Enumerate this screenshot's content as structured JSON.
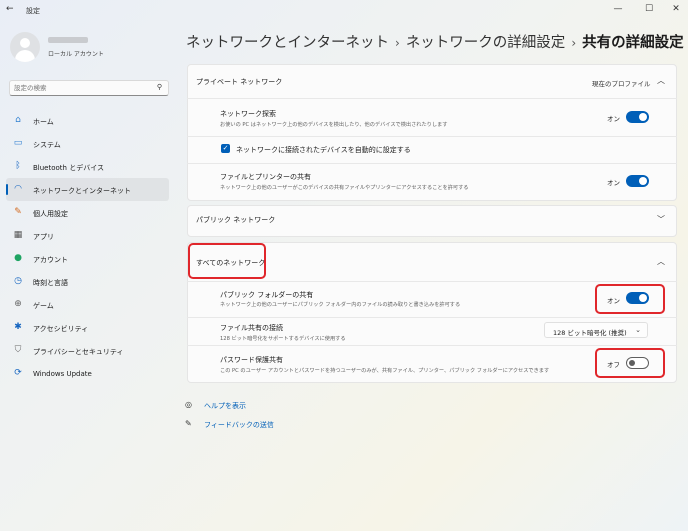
{
  "window": {
    "title": "設定",
    "back_icon": "back-arrow-icon",
    "controls": [
      "minimize",
      "maximize",
      "close"
    ]
  },
  "profile": {
    "account_type": "ローカル アカウント"
  },
  "search": {
    "placeholder": "設定の検索"
  },
  "sidebar": {
    "items": [
      {
        "label": "ホーム",
        "icon": "home-icon"
      },
      {
        "label": "システム",
        "icon": "system-icon"
      },
      {
        "label": "Bluetooth とデバイス",
        "icon": "bluetooth-icon"
      },
      {
        "label": "ネットワークとインターネット",
        "icon": "wifi-icon",
        "active": true
      },
      {
        "label": "個人用設定",
        "icon": "brush-icon"
      },
      {
        "label": "アプリ",
        "icon": "apps-icon"
      },
      {
        "label": "アカウント",
        "icon": "account-icon"
      },
      {
        "label": "時刻と言語",
        "icon": "globe-clock-icon"
      },
      {
        "label": "ゲーム",
        "icon": "gamepad-icon"
      },
      {
        "label": "アクセシビリティ",
        "icon": "accessibility-icon"
      },
      {
        "label": "プライバシーとセキュリティ",
        "icon": "shield-icon"
      },
      {
        "label": "Windows Update",
        "icon": "update-icon"
      }
    ]
  },
  "breadcrumb": {
    "level1": "ネットワークとインターネット",
    "level2": "ネットワークの詳細設定",
    "current": "共有の詳細設定",
    "separator": "›"
  },
  "private": {
    "header": "プライベート ネットワーク",
    "profile_status": "現在のプロファイル",
    "discovery": {
      "title": "ネットワーク探索",
      "desc": "お使いの PC はネットワーク上の他のデバイスを検出したり、他のデバイスで検出されたりします",
      "state": "オン",
      "on": true
    },
    "auto_setup": {
      "label": "ネットワークに接続されたデバイスを自動的に設定する",
      "checked": true
    },
    "file_printer": {
      "title": "ファイルとプリンターの共有",
      "desc": "ネットワーク上の他のユーザーがこのデバイスの共有ファイルやプリンターにアクセスすることを許可する",
      "state": "オン",
      "on": true
    }
  },
  "public": {
    "header": "パブリック ネットワーク"
  },
  "all": {
    "header": "すべてのネットワーク",
    "public_folder": {
      "title": "パブリック フォルダーの共有",
      "desc": "ネットワーク上の他のユーザーにパブリック フォルダー内のファイルの読み取りと書き込みを許可する",
      "state": "オン",
      "on": true
    },
    "file_sharing_conn": {
      "title": "ファイル共有の接続",
      "desc": "128 ビット暗号化をサポートするデバイスに使用する",
      "value": "128 ビット暗号化 (推奨)"
    },
    "password_protect": {
      "title": "パスワード保護共有",
      "desc": "この PC のユーザー アカウントとパスワードを持つユーザーのみが、共有ファイル、プリンター、パブリック フォルダーにアクセスできます",
      "state": "オフ",
      "on": false
    }
  },
  "links": {
    "help": {
      "label": "ヘルプを表示",
      "icon": "help-icon"
    },
    "feedback": {
      "label": "フィードバックの送信",
      "icon": "feedback-icon"
    }
  },
  "colors": {
    "accent": "#005fb8",
    "highlight": "#e0262b"
  }
}
